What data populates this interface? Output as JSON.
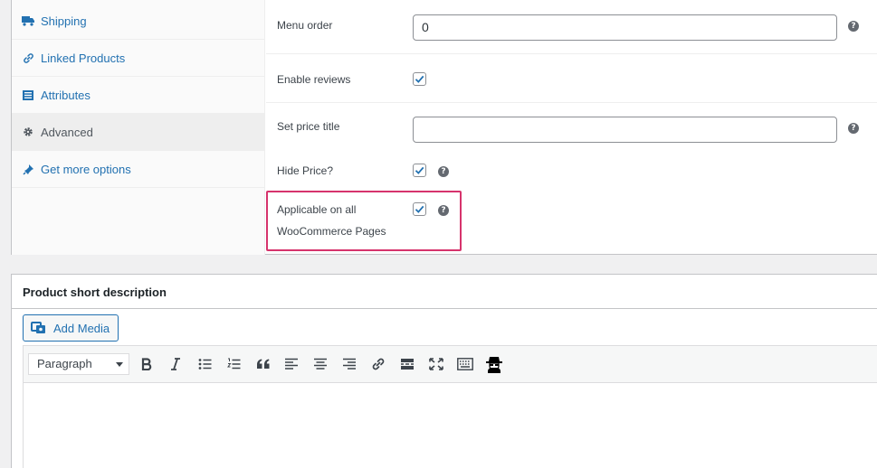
{
  "product_data": {
    "tabs": [
      {
        "label": "Shipping",
        "icon": "truck-icon"
      },
      {
        "label": "Linked Products",
        "icon": "link-icon"
      },
      {
        "label": "Attributes",
        "icon": "list-icon"
      },
      {
        "label": "Advanced",
        "icon": "gear-icon",
        "active": true
      },
      {
        "label": "Get more options",
        "icon": "plugin-icon"
      }
    ],
    "fields": {
      "menu_order": {
        "label": "Menu order",
        "value": "0"
      },
      "enable_reviews": {
        "label": "Enable reviews",
        "checked": true
      },
      "set_price_title": {
        "label": "Set price title",
        "value": ""
      },
      "hide_price": {
        "label": "Hide Price?",
        "checked": true
      },
      "applicable_all": {
        "label_line1": "Applicable on all",
        "label_line2": "WooCommerce Pages",
        "checked": true
      }
    },
    "help_glyph": "?"
  },
  "short_description": {
    "title": "Product short description",
    "add_media_label": "Add Media",
    "format_select": "Paragraph",
    "toolbar_buttons": [
      "bold",
      "italic",
      "bullet-list",
      "numbered-list",
      "blockquote",
      "align-left",
      "align-center",
      "align-right",
      "link",
      "read-more",
      "fullscreen",
      "toolbar-toggle",
      "spy-user"
    ]
  },
  "colors": {
    "link": "#2271b1",
    "highlight_border": "#d6336c",
    "checkmark": "#2271b1"
  }
}
